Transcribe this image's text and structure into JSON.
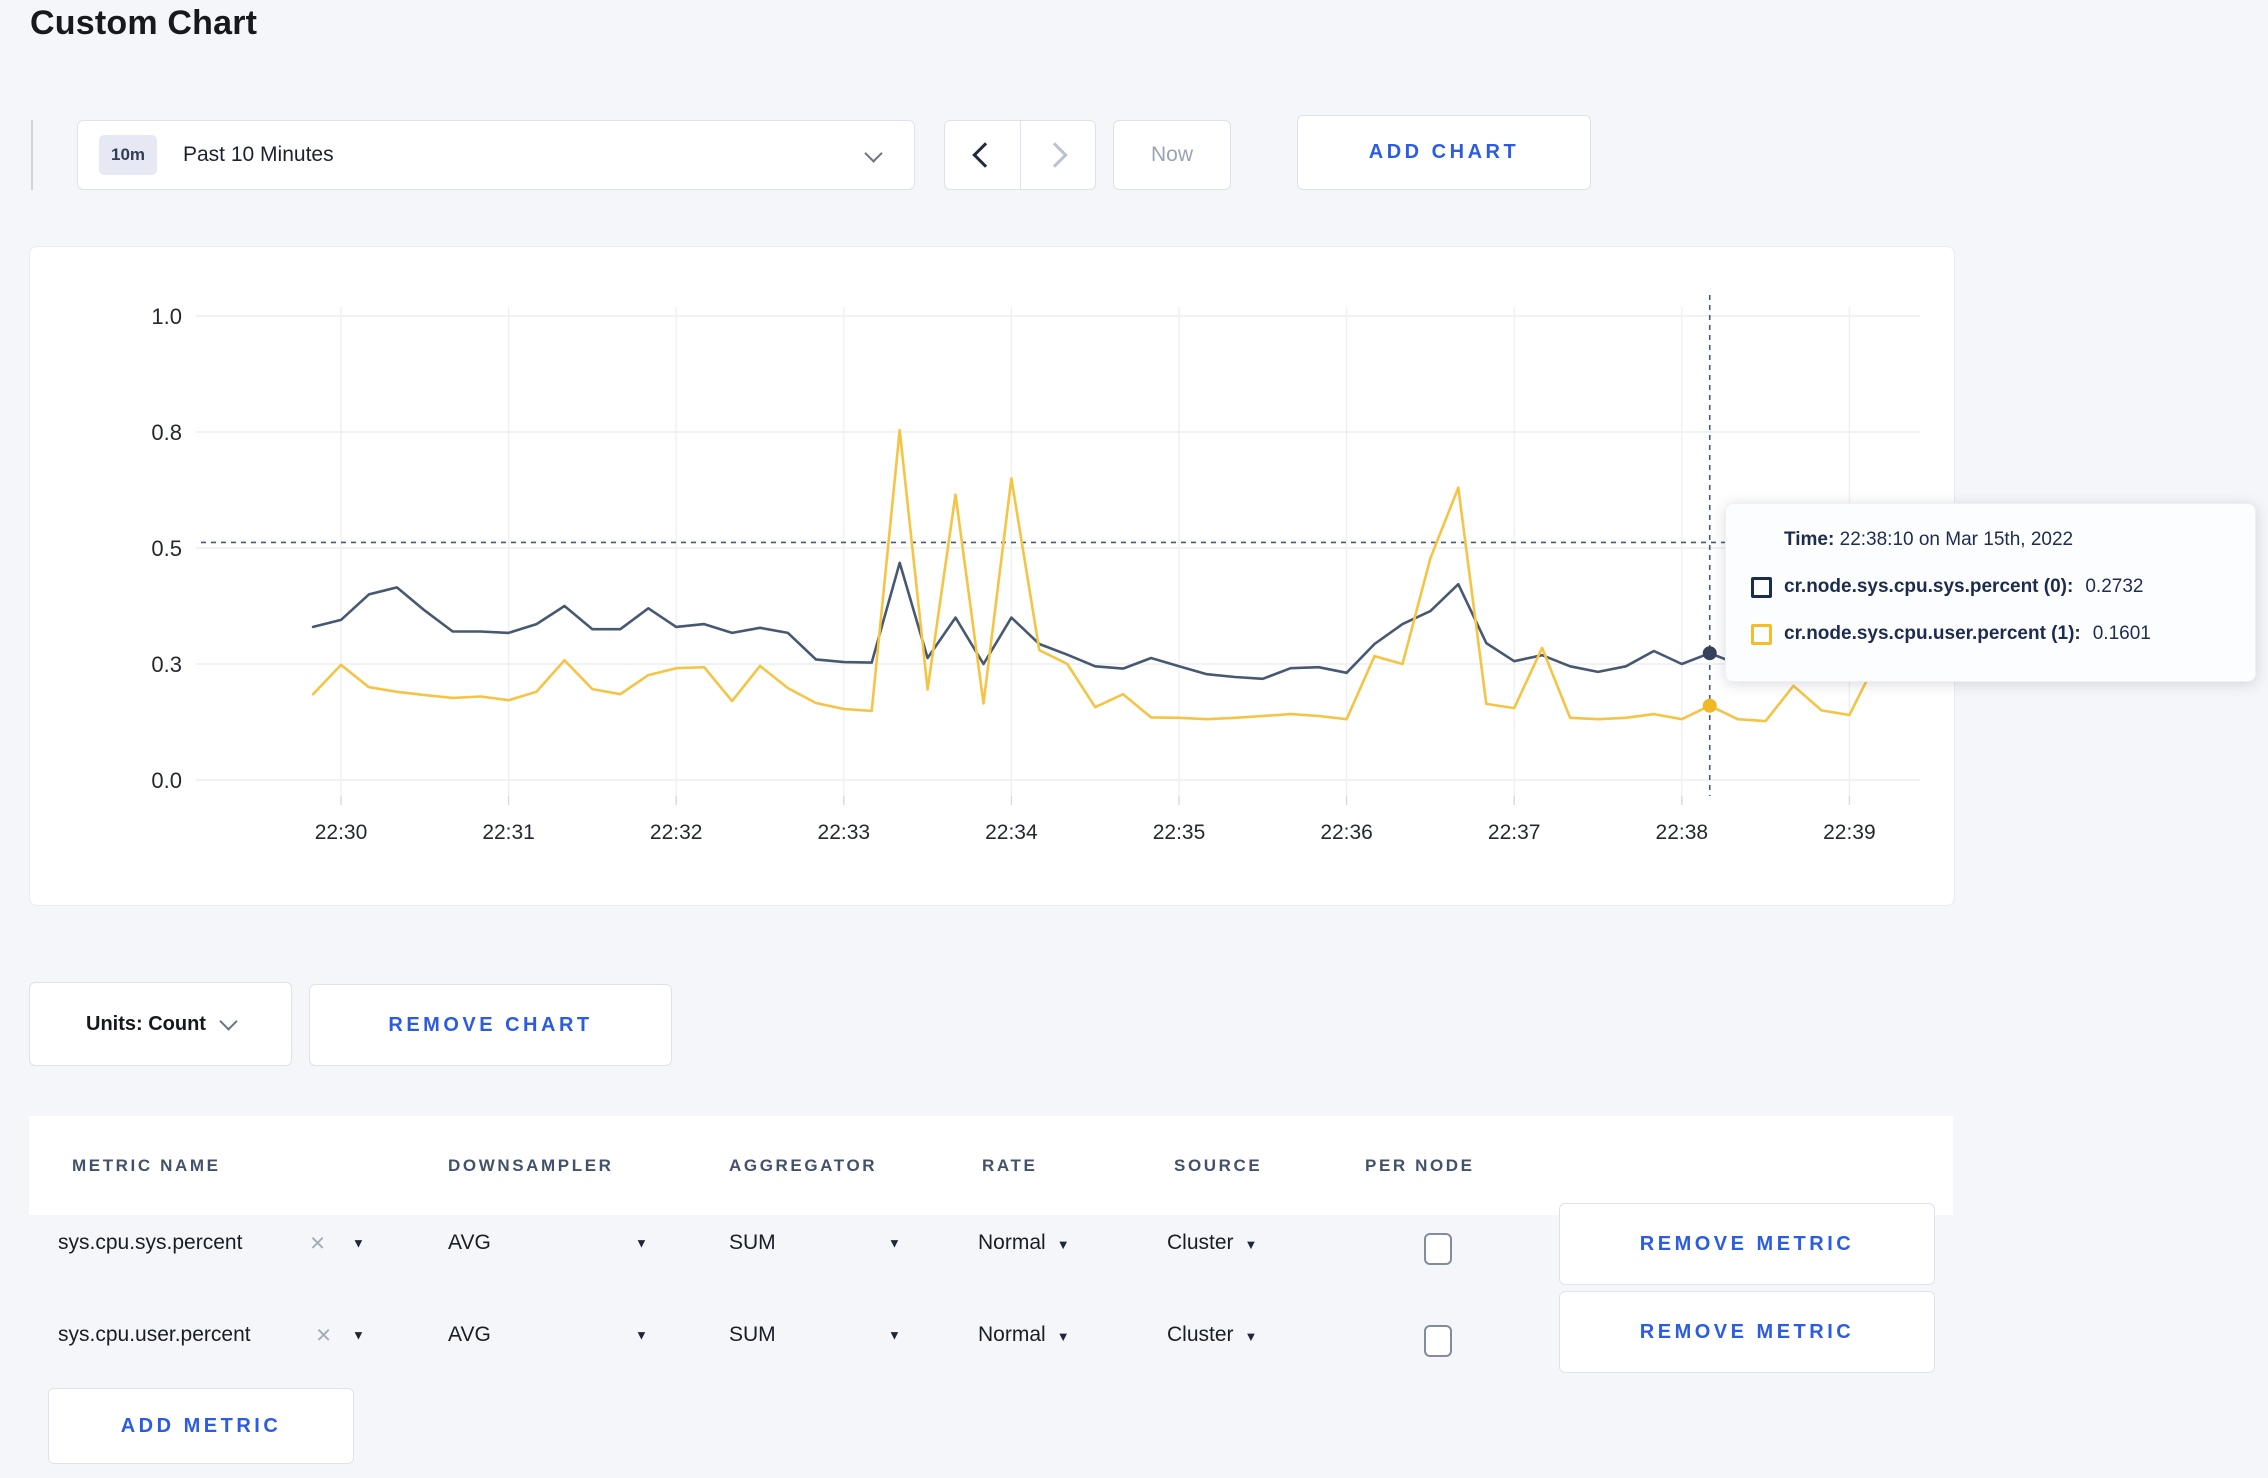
{
  "page": {
    "title": "Custom Chart"
  },
  "toolbar": {
    "time_range": {
      "badge": "10m",
      "label": "Past 10 Minutes"
    },
    "prev_label": "previous time window",
    "next_label": "next time window",
    "now_label": "Now",
    "add_chart_label": "ADD CHART"
  },
  "chart_controls": {
    "units_label": "Units: Count",
    "remove_chart_label": "REMOVE CHART"
  },
  "tooltip": {
    "time_label": "Time:",
    "time_value": "22:38:10 on Mar 15th, 2022",
    "series": [
      {
        "label": "cr.node.sys.cpu.sys.percent (0):",
        "value": "0.2732",
        "color": "#1c2b4e"
      },
      {
        "label": "cr.node.sys.cpu.user.percent (1):",
        "value": "0.1601",
        "color": "#f5bd2a"
      }
    ]
  },
  "metrics_table": {
    "headers": [
      "METRIC NAME",
      "DOWNSAMPLER",
      "AGGREGATOR",
      "RATE",
      "SOURCE",
      "PER NODE"
    ],
    "rows": [
      {
        "metric": "sys.cpu.sys.percent",
        "remove_glyph": "×",
        "downsampler": "AVG",
        "aggregator": "SUM",
        "rate": "Normal",
        "source": "Cluster",
        "per_node_checked": false,
        "remove_label": "REMOVE METRIC"
      },
      {
        "metric": "sys.cpu.user.percent",
        "remove_glyph": "×",
        "downsampler": "AVG",
        "aggregator": "SUM",
        "rate": "Normal",
        "source": "Cluster",
        "per_node_checked": false,
        "remove_label": "REMOVE METRIC"
      }
    ],
    "add_metric_label": "ADD METRIC"
  },
  "chart_data": {
    "type": "line",
    "title": "",
    "xlabel": "",
    "ylabel": "",
    "ylim": [
      0,
      1
    ],
    "grid": true,
    "legend_position": "none",
    "x_start_time": "22:29:50",
    "x_interval_sec": 10,
    "x_tick_labels": [
      "22:30",
      "22:31",
      "22:32",
      "22:33",
      "22:34",
      "22:35",
      "22:36",
      "22:37",
      "22:38",
      "22:39"
    ],
    "y_tick_values": [
      0,
      0.25,
      0.5,
      0.75,
      1.0
    ],
    "y_tick_labels": [
      "0.0",
      "0.3",
      "0.5",
      "0.8",
      "1.0"
    ],
    "crosshair": {
      "index": 50,
      "time": "22:38:10",
      "y_value": 0.512
    },
    "series": [
      {
        "name": "cr.node.sys.cpu.sys.percent",
        "color": "#475872",
        "dot_color": "#36415c",
        "values": [
          0.33,
          0.345,
          0.4,
          0.415,
          0.365,
          0.32,
          0.32,
          0.317,
          0.336,
          0.375,
          0.325,
          0.325,
          0.37,
          0.33,
          0.336,
          0.317,
          0.328,
          0.317,
          0.26,
          0.254,
          0.253,
          0.468,
          0.263,
          0.35,
          0.25,
          0.35,
          0.293,
          0.27,
          0.245,
          0.24,
          0.263,
          0.245,
          0.228,
          0.222,
          0.218,
          0.241,
          0.243,
          0.231,
          0.293,
          0.336,
          0.364,
          0.422,
          0.295,
          0.256,
          0.269,
          0.245,
          0.233,
          0.245,
          0.278,
          0.25,
          0.2732,
          0.25,
          0.262,
          0.27,
          0.261,
          0.272,
          0.28
        ]
      },
      {
        "name": "cr.node.sys.cpu.user.percent",
        "color": "#f5c444",
        "dot_color": "#f0b825",
        "values": [
          0.185,
          0.248,
          0.2,
          0.19,
          0.183,
          0.177,
          0.18,
          0.172,
          0.19,
          0.258,
          0.196,
          0.185,
          0.226,
          0.241,
          0.243,
          0.17,
          0.246,
          0.198,
          0.166,
          0.153,
          0.149,
          0.754,
          0.195,
          0.615,
          0.165,
          0.65,
          0.28,
          0.25,
          0.157,
          0.185,
          0.135,
          0.134,
          0.131,
          0.134,
          0.138,
          0.142,
          0.138,
          0.131,
          0.267,
          0.25,
          0.478,
          0.63,
          0.164,
          0.155,
          0.285,
          0.134,
          0.131,
          0.134,
          0.142,
          0.131,
          0.1601,
          0.131,
          0.127,
          0.203,
          0.15,
          0.14,
          0.26
        ]
      }
    ]
  },
  "colors": {
    "accent_blue": "#2b5ce2",
    "page_bg": "#f4f6f9",
    "gridline": "#ededed",
    "crosshair": "#4a5a75",
    "axis_text": "#24282f"
  }
}
